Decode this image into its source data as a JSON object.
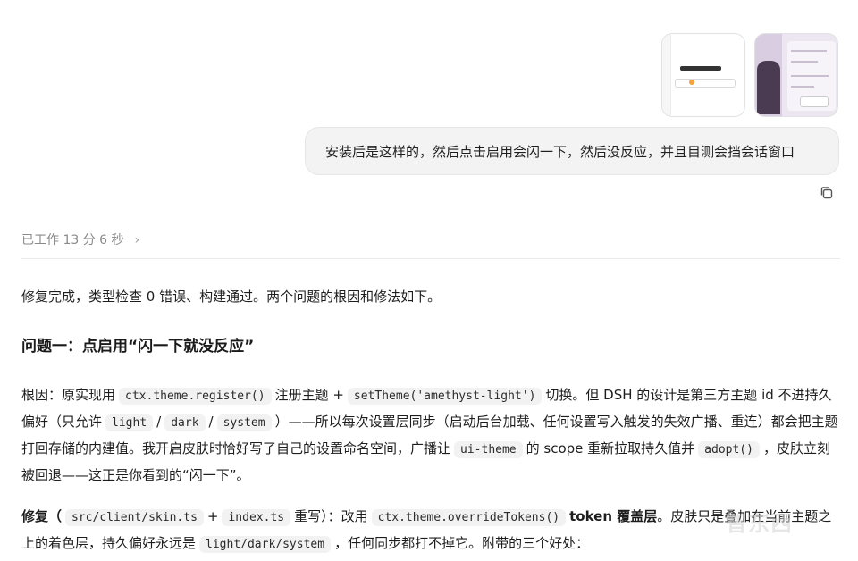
{
  "attachments": [
    {
      "name": "screenshot-1"
    },
    {
      "name": "screenshot-2"
    }
  ],
  "user_message": "安装后是这样的，然后点击启用会闪一下，然后没反应，并且目测会挡会话窗口",
  "worked": {
    "label": "已工作 13 分 6 秒",
    "chevron": "›"
  },
  "response": {
    "summary": "修复完成，类型检查 0 错误、构建通过。两个问题的根因和修法如下。",
    "heading1": "问题一：点启用“闪一下就没反应”",
    "cause": {
      "t1": "根因：原实现用",
      "c1": "ctx.theme.register()",
      "t2": "注册主题 +",
      "c2": "setTheme('amethyst-light')",
      "t3": "切换。但 DSH 的设计是第三方主题 id 不进持久偏好（只允许",
      "c3": "light",
      "t4": "/",
      "c4": "dark",
      "t5": "/",
      "c5": "system",
      "t6": "）——所以每次设置层同步（启动后台加载、任何设置写入触发的失效广播、重连）都会把主题打回存储的内建值。我开启皮肤时恰好写了自己的设置命名空间，广播让",
      "c6": "ui-theme",
      "t7": "的 scope 重新拉取持久值并",
      "c7": "adopt()",
      "t8": "，皮肤立刻被回退——这正是你看到的“闪一下”。"
    },
    "fix": {
      "t1": "修复（",
      "c1": "src/client/skin.ts",
      "t2": "+",
      "c2": "index.ts",
      "t3": "重写）：改用",
      "c3": "ctx.theme.overrideTokens()",
      "b1": "token 覆盖层",
      "t4": "。皮肤只是叠加在当前主题之上的着色层，持久偏好永远是",
      "c4": "light/dark/system",
      "t5": "，任何同步都打不掉它。附带的三个好处："
    }
  },
  "watermark": "智东西"
}
